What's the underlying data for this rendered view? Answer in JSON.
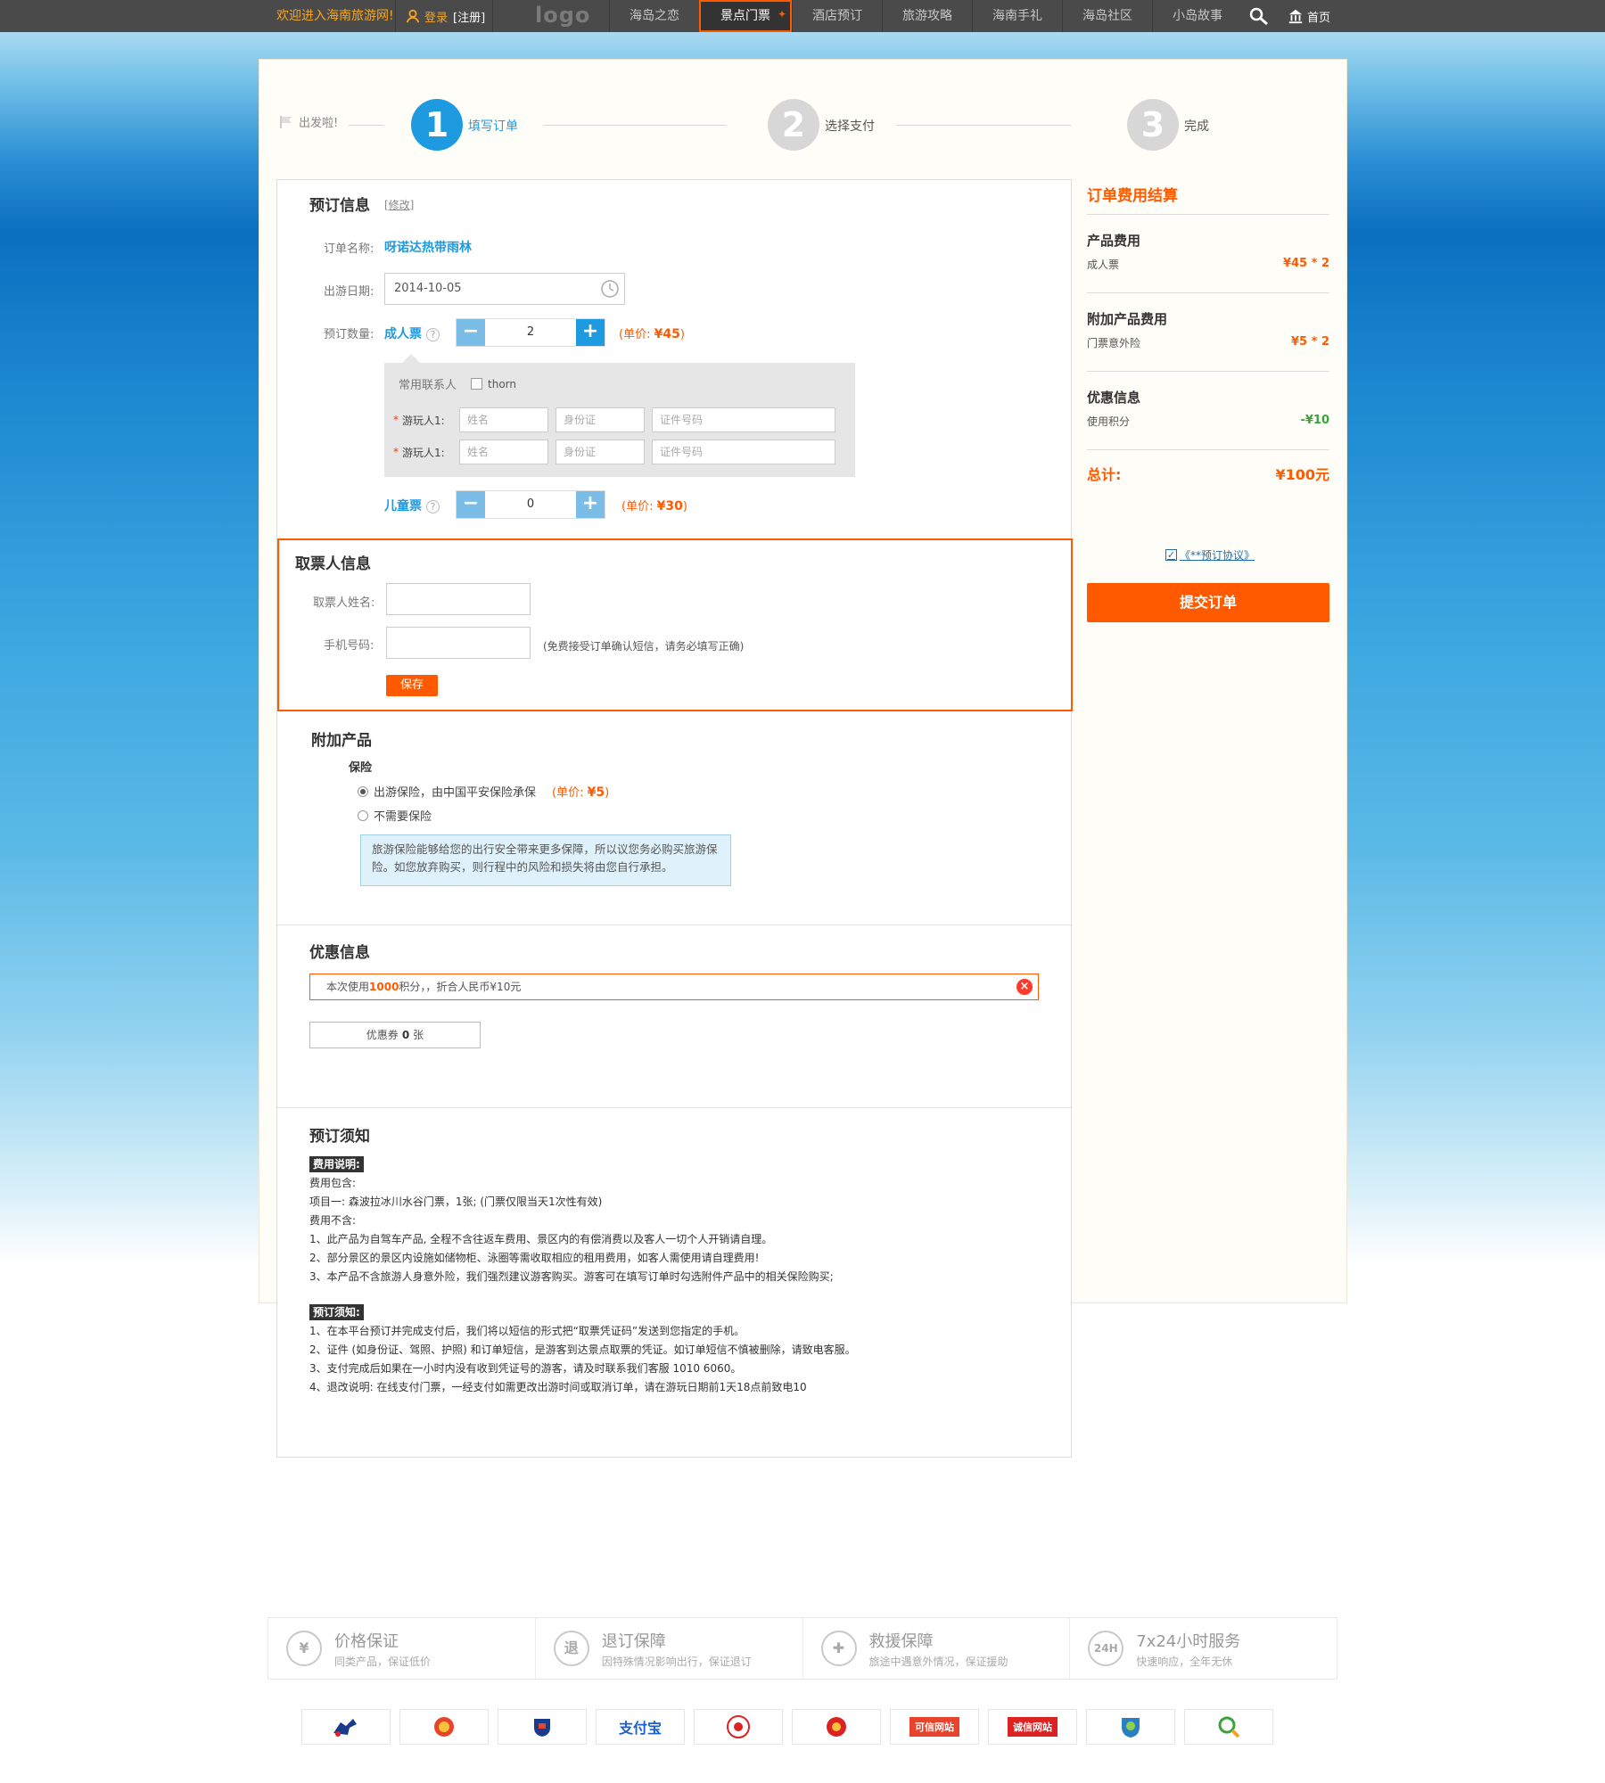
{
  "topbar": {
    "welcome": "欢迎进入海南旅游网!",
    "login": "登录",
    "register": "[注册]",
    "logo": "logo",
    "nav": [
      "海岛之恋",
      "景点门票",
      "酒店预订",
      "旅游攻略",
      "海南手礼",
      "海岛社区",
      "小岛故事"
    ],
    "active_nav": "景点门票",
    "home": "首页"
  },
  "steps": {
    "start": "出发啦!",
    "items": [
      {
        "num": "1",
        "label": "填写订单"
      },
      {
        "num": "2",
        "label": "选择支付"
      },
      {
        "num": "3",
        "label": "完成"
      }
    ]
  },
  "booking": {
    "title": "预订信息",
    "edit": "[修改]",
    "order_name_label": "订单名称:",
    "order_name": "呀诺达热带雨林",
    "date_label": "出游日期:",
    "date": "2014-10-05",
    "qty_label": "预订数量:",
    "adult": {
      "name": "成人票",
      "qty": "2",
      "price_prefix": "(单价: ",
      "price": "¥45",
      "price_suffix": ")"
    },
    "child": {
      "name": "儿童票",
      "qty": "0",
      "price_prefix": "(单价: ",
      "price": "¥30",
      "price_suffix": ")"
    },
    "contacts_label": "常用联系人",
    "contact_name": "thorn",
    "traveler_label": "游玩人1:",
    "ph_name": "姓名",
    "ph_id": "身份证",
    "ph_idno": "证件号码"
  },
  "pickup": {
    "title": "取票人信息",
    "name_label": "取票人姓名:",
    "phone_label": "手机号码:",
    "hint": "(免费接受订单确认短信，请务必填写正确)",
    "save": "保存"
  },
  "addon": {
    "title": "附加产品",
    "sub": "保险",
    "opt1": "出游保险，由中国平安保险承保",
    "opt1_price_prefix": "(单价: ",
    "opt1_price": "¥5",
    "opt1_price_suffix": ")",
    "opt2": "不需要保险",
    "note": "旅游保险能够给您的出行安全带来更多保障，所以议您务必购买旅游保险。如您放弃购买，则行程中的风险和损失将由您自行承担。"
  },
  "discount": {
    "title": "优惠信息",
    "use_pre": "本次使用",
    "points": "1000",
    "use_post": "积分，，折合人民币¥10元",
    "coupon_pre": "优惠券",
    "coupon_num": "0",
    "coupon_post": "张"
  },
  "notice": {
    "title": "预订须知",
    "fee_tag": "费用说明:",
    "fee_lines": [
      "费用包含:",
      "项目一: 森波拉冰川水谷门票，1张; (门票仅限当天1次性有效)",
      "费用不含:",
      "1、此产品为自驾车产品, 全程不含往返车费用、景区内的有偿消费以及客人一切个人开销请自理。",
      "2、部分景区的景区内设施如储物柜、泳圈等需收取相应的租用费用，如客人需使用请自理费用!",
      "3、本产品不含旅游人身意外险，我们强烈建议游客购买。游客可在填写订单时勾选附件产品中的相关保险购买;"
    ],
    "book_tag": "预订须知:",
    "book_lines": [
      "1、在本平台预订并完成支付后，我们将以短信的形式把“取票凭证码”发送到您指定的手机。",
      "2、证件 (如身份证、驾照、护照) 和订单短信，是游客到达景点取票的凭证。如订单短信不慎被删除，请致电客服。",
      "3、支付完成后如果在一小时内没有收到凭证号的游客，请及时联系我们客服 1010 6060。",
      "4、退改说明: 在线支付门票，一经支付如需更改出游时间或取消订单，请在游玩日期前1天18点前致电10"
    ]
  },
  "summary": {
    "title": "订单费用结算",
    "product_title": "产品费用",
    "product_item": "成人票",
    "product_val": "¥45 * 2",
    "addon_title": "附加产品费用",
    "addon_item": "门票意外险",
    "addon_val": "¥5 * 2",
    "discount_title": "优惠信息",
    "discount_item": "使用积分",
    "discount_val": "-¥10",
    "total_label": "总计:",
    "total_val": "¥100元",
    "agree": "《**预订协议》",
    "submit": "提交订单"
  },
  "guarantees": [
    {
      "icon": "¥",
      "title": "价格保证",
      "desc": "同类产品，保证低价"
    },
    {
      "icon": "退",
      "title": "退订保障",
      "desc": "因特殊情况影响出行，保证退订"
    },
    {
      "icon": "✚",
      "title": "救援保障",
      "desc": "旅途中遇意外情况，保证援助"
    },
    {
      "icon": "24H",
      "title": "7x24小时服务",
      "desc": "快速响应，全年无休"
    }
  ],
  "badges": [
    "",
    "",
    "",
    "支付宝",
    "",
    "",
    "可信网站",
    "诚信网站",
    "",
    ""
  ],
  "colors": {
    "accent": "#ff5a00",
    "blue": "#1e9ae0"
  }
}
